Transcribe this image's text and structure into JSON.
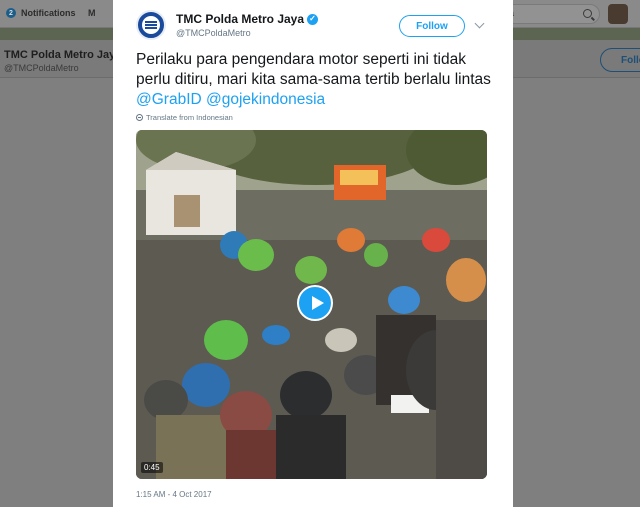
{
  "background": {
    "nav": {
      "notifications_badge": "2",
      "notifications_label": "Notifications",
      "messages_label": "M",
      "search_fragment": "a"
    },
    "profile": {
      "name": "TMC Polda Metro Jaya",
      "handle": "@TMCPoldaMetro",
      "follow_label": "Follo"
    }
  },
  "tweet": {
    "name": "TMC Polda Metro Jaya",
    "handle": "@TMCPoldaMetro",
    "follow_label": "Follow",
    "text_plain": "Perilaku para pengendara motor seperti ini tidak perlu ditiru, mari kita sama-sama tertib berlalu lintas ",
    "mention_1": "@GrabID",
    "mention_2": "@gojekindonesia",
    "translate_label": "Translate from Indonesian",
    "video_duration": "0:45",
    "timestamp": "1:15 AM - 4 Oct 2017"
  },
  "colors": {
    "accent": "#1da1f2",
    "overlay": "#7f7f7f"
  },
  "icons": [
    "notifications-icon",
    "messages-icon",
    "search-icon",
    "verified-icon",
    "chevron-down-icon",
    "globe-icon",
    "play-icon"
  ]
}
